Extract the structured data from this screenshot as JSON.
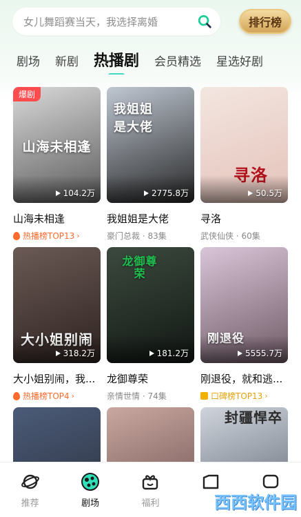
{
  "search": {
    "placeholder": "女儿舞蹈赛当天，我选择离婚",
    "icon": "search-icon"
  },
  "rank_button": {
    "label": "排行榜"
  },
  "tabs": [
    {
      "label": "剧场",
      "active": false
    },
    {
      "label": "新剧",
      "active": false
    },
    {
      "label": "热播剧",
      "active": true
    },
    {
      "label": "会员精选",
      "active": false
    },
    {
      "label": "星选好剧",
      "active": false
    }
  ],
  "cards": [
    {
      "title": "山海未相逢",
      "plays": "104.2万",
      "badge": "爆剧",
      "poster_text": "山海未相逢",
      "sub": "热播榜TOP13",
      "sub_type": "hot",
      "colors": [
        "#d9d9d9",
        "#5b5b5b"
      ]
    },
    {
      "title": "我姐姐是大佬",
      "plays": "2775.8万",
      "badge": "",
      "poster_text": "我姐姐是大佬",
      "sub": "豪门总裁 · 83集",
      "sub_type": "tag",
      "colors": [
        "#bfc7d2",
        "#262626"
      ]
    },
    {
      "title": "寻洛",
      "plays": "50.5万",
      "badge": "",
      "poster_text": "寻洛",
      "sub": "武侠仙侠 · 60集",
      "sub_type": "tag",
      "colors": [
        "#f3e6e0",
        "#e4c2b9"
      ]
    },
    {
      "title": "大小姐别闹，我...",
      "plays": "318.2万",
      "badge": "",
      "poster_text": "大小姐别闹",
      "sub": "热播榜TOP4",
      "sub_type": "hot",
      "colors": [
        "#6b5a55",
        "#2d2220"
      ]
    },
    {
      "title": "龙御尊荣",
      "plays": "181.2万",
      "badge": "",
      "poster_text": "龙御尊荣",
      "sub": "亲情世情 · 74集",
      "sub_type": "tag",
      "colors": [
        "#3c4a3e",
        "#121714"
      ]
    },
    {
      "title": "刚退役，就和逃...",
      "plays": "5555.7万",
      "badge": "",
      "poster_text": "刚退役",
      "sub": "口碑榜TOP13",
      "sub_type": "word",
      "colors": [
        "#d9c5d8",
        "#6f5a66"
      ]
    },
    {
      "title": "",
      "plays": "",
      "badge": "",
      "poster_text": "",
      "sub": "",
      "sub_type": "",
      "colors": [
        "#4b5b78",
        "#2a2f3b"
      ]
    },
    {
      "title": "",
      "plays": "",
      "badge": "",
      "poster_text": "",
      "sub": "",
      "sub_type": "",
      "colors": [
        "#c9a8a0",
        "#6b4c4c"
      ]
    },
    {
      "title": "",
      "plays": "",
      "badge": "",
      "poster_text": "封疆悍卒",
      "sub": "",
      "sub_type": "",
      "colors": [
        "#cfd4dc",
        "#5a626e"
      ]
    }
  ],
  "bottom_nav": [
    {
      "label": "推荐",
      "icon": "planet-icon",
      "active": false
    },
    {
      "label": "剧场",
      "icon": "theater-icon",
      "active": true
    },
    {
      "label": "福利",
      "icon": "gift-icon",
      "active": false
    },
    {
      "label": "",
      "icon": "folder-icon",
      "active": false
    },
    {
      "label": "",
      "icon": "message-icon",
      "active": false
    }
  ],
  "watermark": "西西软件园"
}
